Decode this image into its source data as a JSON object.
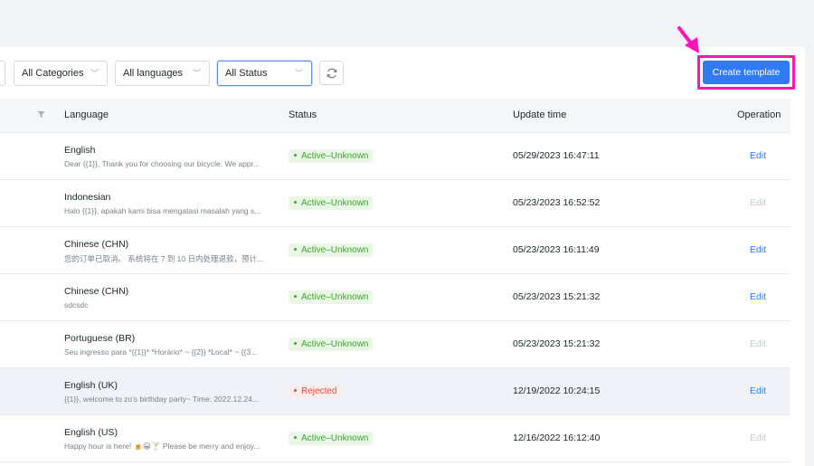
{
  "filters": {
    "categories": "All Categories",
    "languages": "All languages",
    "status": "All Status"
  },
  "toolbar": {
    "create_label": "Create template"
  },
  "table": {
    "headers": {
      "language": "Language",
      "status": "Status",
      "update_time": "Update time",
      "operation": "Operation"
    },
    "rows": [
      {
        "language": "English",
        "preview": "Dear {{1}}, Thank you for choosing our bicycle. We appr...",
        "status": "Active–Unknown",
        "time": "05/29/2023 16:47:11",
        "edit": "Edit"
      },
      {
        "language": "Indonesian",
        "preview": "Halo {{1}}, apakah kami bisa mengatasi masalah yang s...",
        "status": "Active–Unknown",
        "time": "05/23/2023 16:52:52",
        "edit": "Edit"
      },
      {
        "language": "Chinese (CHN)",
        "preview": "您的订单已取消。 系统将在 7 到 10 日内处理退款，预计...",
        "status": "Active–Unknown",
        "time": "05/23/2023 16:11:49",
        "edit": "Edit"
      },
      {
        "language": "Chinese (CHN)",
        "preview": "sdcsdc",
        "status": "Active–Unknown",
        "time": "05/23/2023 15:21:32",
        "edit": "Edit"
      },
      {
        "language": "Portuguese (BR)",
        "preview": "Seu ingresso para *{{1}}* *Horário* ~ {{2}} *Local* ~ {{3...",
        "status": "Active–Unknown",
        "time": "05/23/2023 15:21:32",
        "edit": "Edit"
      },
      {
        "language": "English (UK)",
        "preview": "{{1}}, welcome to zo's birthday party~ Time: 2022.12.24...",
        "status": "Rejected",
        "time": "12/19/2022 10:24:15",
        "edit": "Edit"
      },
      {
        "language": "English (US)",
        "preview": "Happy hour is here! 🍺😀🍸 Please be merry and enjoy...",
        "status": "Active–Unknown",
        "time": "12/16/2022 16:12:40",
        "edit": "Edit"
      }
    ]
  },
  "colors": {
    "accent": "#2f7bf5",
    "highlight": "#ff16b8",
    "active": "#3aa829",
    "rejected": "#e8473b"
  }
}
